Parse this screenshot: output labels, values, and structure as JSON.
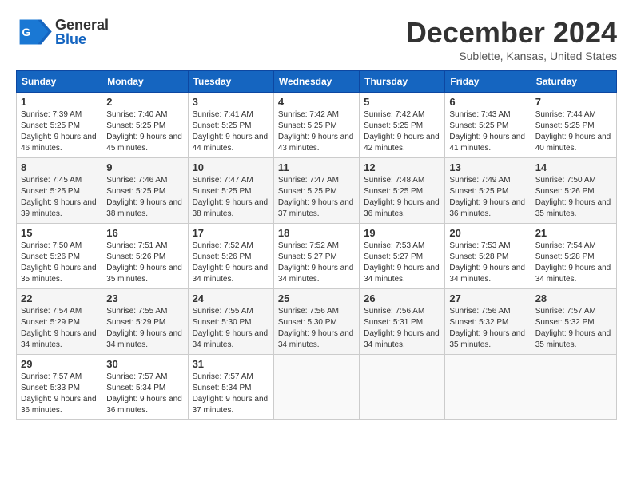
{
  "header": {
    "logo_general": "General",
    "logo_blue": "Blue",
    "month_title": "December 2024",
    "subtitle": "Sublette, Kansas, United States"
  },
  "calendar": {
    "days_of_week": [
      "Sunday",
      "Monday",
      "Tuesday",
      "Wednesday",
      "Thursday",
      "Friday",
      "Saturday"
    ],
    "weeks": [
      [
        {
          "day": "1",
          "sunrise": "7:39 AM",
          "sunset": "5:25 PM",
          "daylight": "9 hours and 46 minutes."
        },
        {
          "day": "2",
          "sunrise": "7:40 AM",
          "sunset": "5:25 PM",
          "daylight": "9 hours and 45 minutes."
        },
        {
          "day": "3",
          "sunrise": "7:41 AM",
          "sunset": "5:25 PM",
          "daylight": "9 hours and 44 minutes."
        },
        {
          "day": "4",
          "sunrise": "7:42 AM",
          "sunset": "5:25 PM",
          "daylight": "9 hours and 43 minutes."
        },
        {
          "day": "5",
          "sunrise": "7:42 AM",
          "sunset": "5:25 PM",
          "daylight": "9 hours and 42 minutes."
        },
        {
          "day": "6",
          "sunrise": "7:43 AM",
          "sunset": "5:25 PM",
          "daylight": "9 hours and 41 minutes."
        },
        {
          "day": "7",
          "sunrise": "7:44 AM",
          "sunset": "5:25 PM",
          "daylight": "9 hours and 40 minutes."
        }
      ],
      [
        {
          "day": "8",
          "sunrise": "7:45 AM",
          "sunset": "5:25 PM",
          "daylight": "9 hours and 39 minutes."
        },
        {
          "day": "9",
          "sunrise": "7:46 AM",
          "sunset": "5:25 PM",
          "daylight": "9 hours and 38 minutes."
        },
        {
          "day": "10",
          "sunrise": "7:47 AM",
          "sunset": "5:25 PM",
          "daylight": "9 hours and 38 minutes."
        },
        {
          "day": "11",
          "sunrise": "7:47 AM",
          "sunset": "5:25 PM",
          "daylight": "9 hours and 37 minutes."
        },
        {
          "day": "12",
          "sunrise": "7:48 AM",
          "sunset": "5:25 PM",
          "daylight": "9 hours and 36 minutes."
        },
        {
          "day": "13",
          "sunrise": "7:49 AM",
          "sunset": "5:25 PM",
          "daylight": "9 hours and 36 minutes."
        },
        {
          "day": "14",
          "sunrise": "7:50 AM",
          "sunset": "5:26 PM",
          "daylight": "9 hours and 35 minutes."
        }
      ],
      [
        {
          "day": "15",
          "sunrise": "7:50 AM",
          "sunset": "5:26 PM",
          "daylight": "9 hours and 35 minutes."
        },
        {
          "day": "16",
          "sunrise": "7:51 AM",
          "sunset": "5:26 PM",
          "daylight": "9 hours and 35 minutes."
        },
        {
          "day": "17",
          "sunrise": "7:52 AM",
          "sunset": "5:26 PM",
          "daylight": "9 hours and 34 minutes."
        },
        {
          "day": "18",
          "sunrise": "7:52 AM",
          "sunset": "5:27 PM",
          "daylight": "9 hours and 34 minutes."
        },
        {
          "day": "19",
          "sunrise": "7:53 AM",
          "sunset": "5:27 PM",
          "daylight": "9 hours and 34 minutes."
        },
        {
          "day": "20",
          "sunrise": "7:53 AM",
          "sunset": "5:28 PM",
          "daylight": "9 hours and 34 minutes."
        },
        {
          "day": "21",
          "sunrise": "7:54 AM",
          "sunset": "5:28 PM",
          "daylight": "9 hours and 34 minutes."
        }
      ],
      [
        {
          "day": "22",
          "sunrise": "7:54 AM",
          "sunset": "5:29 PM",
          "daylight": "9 hours and 34 minutes."
        },
        {
          "day": "23",
          "sunrise": "7:55 AM",
          "sunset": "5:29 PM",
          "daylight": "9 hours and 34 minutes."
        },
        {
          "day": "24",
          "sunrise": "7:55 AM",
          "sunset": "5:30 PM",
          "daylight": "9 hours and 34 minutes."
        },
        {
          "day": "25",
          "sunrise": "7:56 AM",
          "sunset": "5:30 PM",
          "daylight": "9 hours and 34 minutes."
        },
        {
          "day": "26",
          "sunrise": "7:56 AM",
          "sunset": "5:31 PM",
          "daylight": "9 hours and 34 minutes."
        },
        {
          "day": "27",
          "sunrise": "7:56 AM",
          "sunset": "5:32 PM",
          "daylight": "9 hours and 35 minutes."
        },
        {
          "day": "28",
          "sunrise": "7:57 AM",
          "sunset": "5:32 PM",
          "daylight": "9 hours and 35 minutes."
        }
      ],
      [
        {
          "day": "29",
          "sunrise": "7:57 AM",
          "sunset": "5:33 PM",
          "daylight": "9 hours and 36 minutes."
        },
        {
          "day": "30",
          "sunrise": "7:57 AM",
          "sunset": "5:34 PM",
          "daylight": "9 hours and 36 minutes."
        },
        {
          "day": "31",
          "sunrise": "7:57 AM",
          "sunset": "5:34 PM",
          "daylight": "9 hours and 37 minutes."
        },
        null,
        null,
        null,
        null
      ]
    ]
  }
}
